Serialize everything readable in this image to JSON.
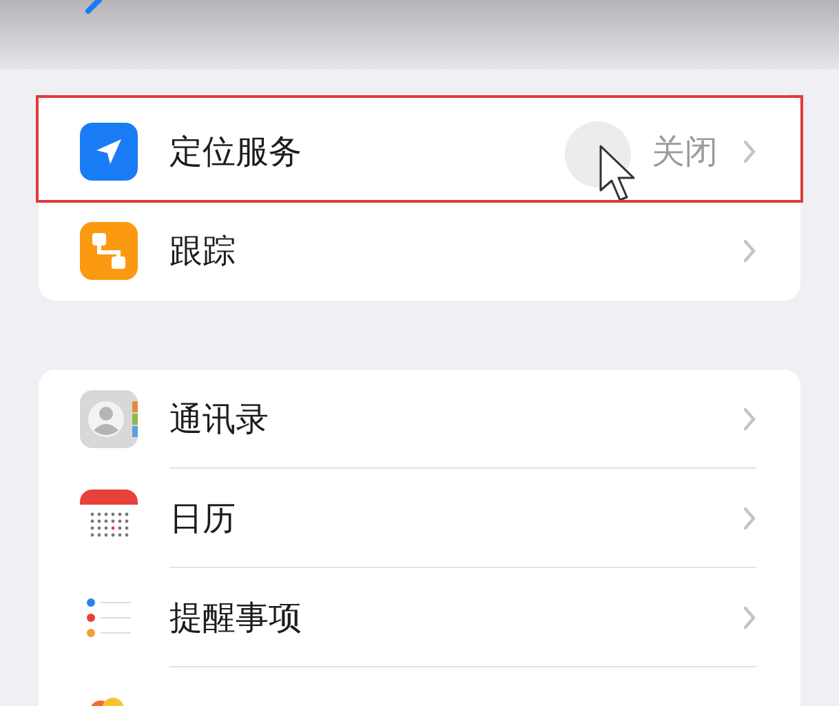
{
  "groups": [
    {
      "items": [
        {
          "label": "定位服务",
          "value": "关闭",
          "highlighted": true
        },
        {
          "label": "跟踪",
          "highlighted": false
        }
      ]
    },
    {
      "items": [
        {
          "label": "通讯录",
          "highlighted": false
        },
        {
          "label": "日历",
          "highlighted": false
        },
        {
          "label": "提醒事项",
          "highlighted": false
        }
      ]
    }
  ]
}
